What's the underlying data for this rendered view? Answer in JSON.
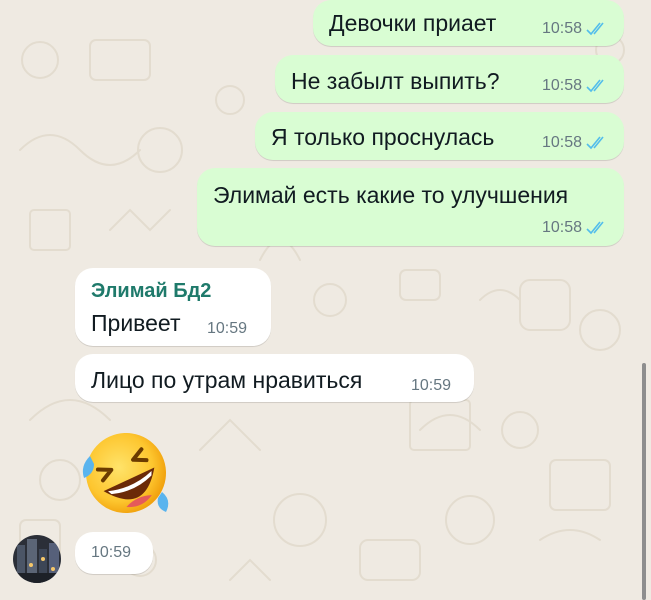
{
  "outgoing": [
    {
      "text": "Девочки приает",
      "time": "10:58"
    },
    {
      "text": "Не забылт выпить?",
      "time": "10:58"
    },
    {
      "text": "Я только проснулась",
      "time": "10:58"
    },
    {
      "text": "Элимай есть какие то улучшения",
      "time": "10:58"
    }
  ],
  "incoming": [
    {
      "sender": "Элимай Бд2",
      "text": "Привеет",
      "time": "10:59"
    },
    {
      "text": "Лицо по утрам нравиться",
      "time": "10:59"
    },
    {
      "emoji": "rofl-emoji",
      "time": "10:59"
    }
  ],
  "read_status": "read",
  "colors": {
    "outgoing_bubble": "#d9fdd3",
    "incoming_bubble": "#ffffff",
    "read_ticks": "#53bdeb",
    "sender_name": "#1f7a6b",
    "background": "#efeae2"
  }
}
